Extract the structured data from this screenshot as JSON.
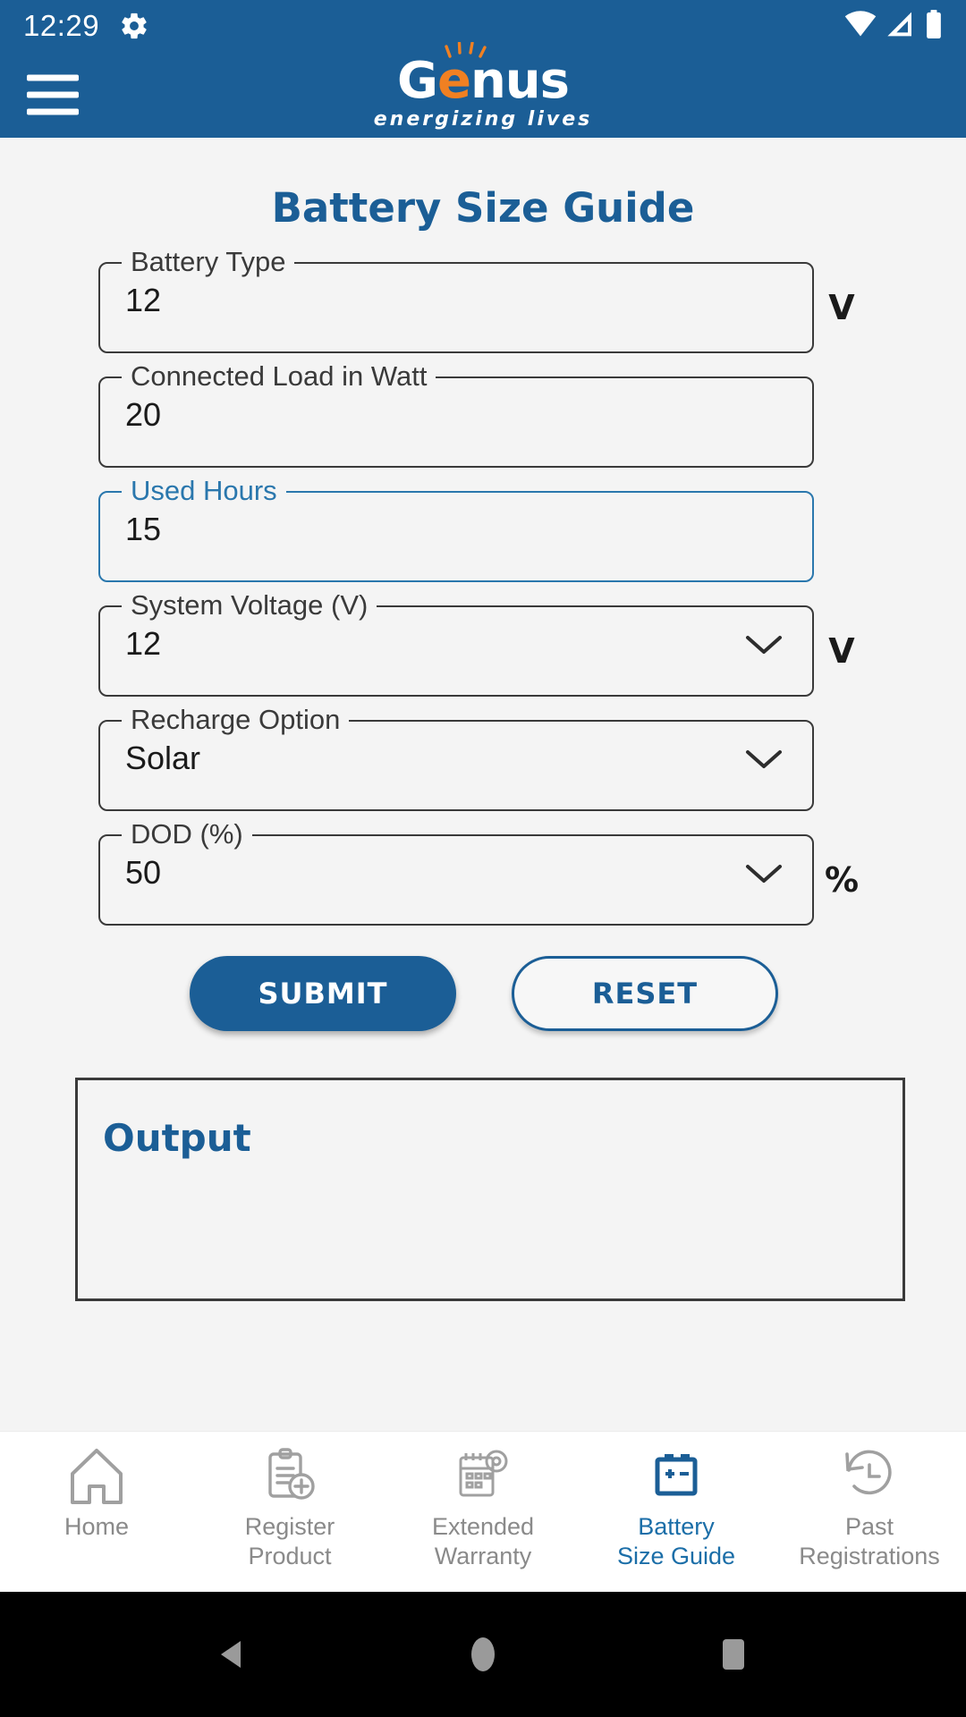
{
  "status_bar": {
    "time": "12:29",
    "icons": [
      "gear-icon",
      "wifi-icon",
      "cellular-signal-icon",
      "battery-icon"
    ]
  },
  "app_bar": {
    "menu_icon": "hamburger-menu-icon",
    "brand_part1": "G",
    "brand_part2": "e",
    "brand_part3": "nus",
    "tagline": "energizing lives"
  },
  "page": {
    "title": "Battery Size Guide"
  },
  "form": {
    "fields": [
      {
        "label": "Battery Type",
        "value": "12",
        "unit": "V",
        "type": "text",
        "focused": false
      },
      {
        "label": "Connected Load in Watt",
        "value": "20",
        "unit": "",
        "type": "text",
        "focused": false
      },
      {
        "label": "Used Hours",
        "value": "15",
        "unit": "",
        "type": "text",
        "focused": true
      },
      {
        "label": "System Voltage (V)",
        "value": "12",
        "unit": "V",
        "type": "select",
        "focused": false
      },
      {
        "label": "Recharge Option",
        "value": "Solar",
        "unit": "",
        "type": "select",
        "focused": false
      },
      {
        "label": "DOD (%)",
        "value": "50",
        "unit": "%",
        "type": "select",
        "focused": false
      }
    ]
  },
  "actions": {
    "submit_label": "SUBMIT",
    "reset_label": "RESET"
  },
  "output": {
    "title": "Output"
  },
  "bottom_nav": {
    "items": [
      {
        "label": "Home",
        "icon": "home-icon",
        "active": false
      },
      {
        "label": "Register\nProduct",
        "line1": "Register",
        "line2": "Product",
        "icon": "clipboard-add-icon",
        "active": false
      },
      {
        "label": "Extended\nWarranty",
        "line1": "Extended",
        "line2": "Warranty",
        "icon": "calendar-gear-icon",
        "active": false
      },
      {
        "label": "Battery\nSize Guide",
        "line1": "Battery",
        "line2": "Size Guide",
        "icon": "battery-icon",
        "active": true
      },
      {
        "label": "Past\nRegistrations",
        "line1": "Past",
        "line2": "Registrations",
        "icon": "history-clock-icon",
        "active": false
      }
    ]
  },
  "android_nav": {
    "back": "back-triangle-icon",
    "home": "home-circle-icon",
    "recents": "recents-square-icon"
  },
  "colors": {
    "brand_blue": "#1b5e96",
    "brand_orange": "#f08022",
    "focus_blue": "#2a77ad",
    "page_bg": "#f4f4f4",
    "nav_inactive": "#8a8a8a"
  }
}
